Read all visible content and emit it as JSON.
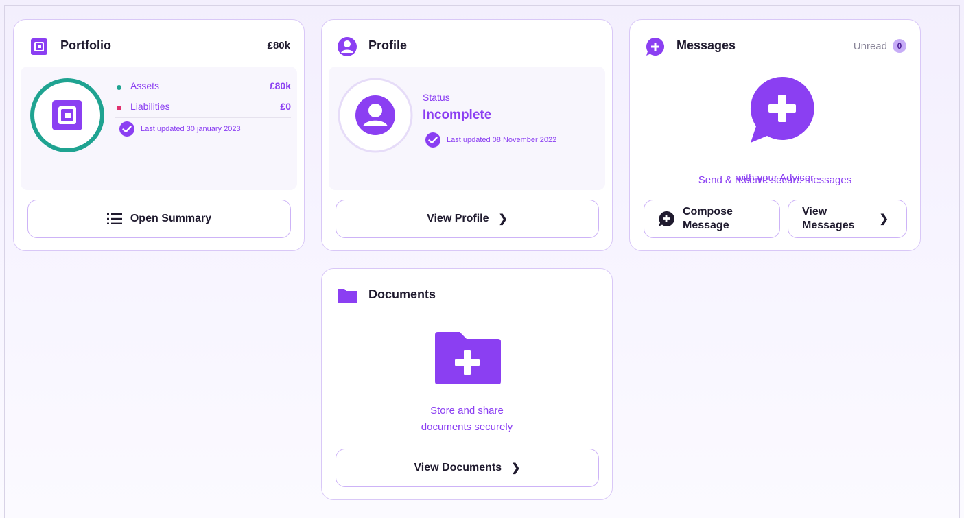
{
  "portfolio": {
    "title": "Portfolio",
    "total": "£80k",
    "assets_label": "Assets",
    "assets_value": "£80k",
    "liabilities_label": "Liabilities",
    "liabilities_value": "£0",
    "updated": "Last updated 30 january 2023",
    "button": "Open Summary"
  },
  "profile": {
    "title": "Profile",
    "status_label": "Status",
    "status_value": "Incomplete",
    "updated": "Last updated 08 November 2022",
    "button": "View Profile"
  },
  "messages": {
    "title": "Messages",
    "unread_label": "Unread",
    "unread_count": "0",
    "description_line1": "Send & receive secure messages",
    "description_line2": "with your Adviser",
    "compose_line1": "Compose",
    "compose_line2": "Message",
    "view_line1": "View",
    "view_line2": "Messages"
  },
  "documents": {
    "title": "Documents",
    "description_line1": "Store and share",
    "description_line2": "documents securely",
    "button": "View Documents"
  },
  "colors": {
    "accent": "#8b3ff2",
    "teal": "#1fa391",
    "pink": "#e0306e",
    "border": "#d9c8f7"
  },
  "icons": {
    "portfolio": "wallet-icon",
    "profile": "user-icon",
    "messages": "chat-plus-icon",
    "documents": "folder-icon",
    "check": "check-circle-icon",
    "list": "list-icon",
    "chevron": "chevron-right-icon"
  }
}
